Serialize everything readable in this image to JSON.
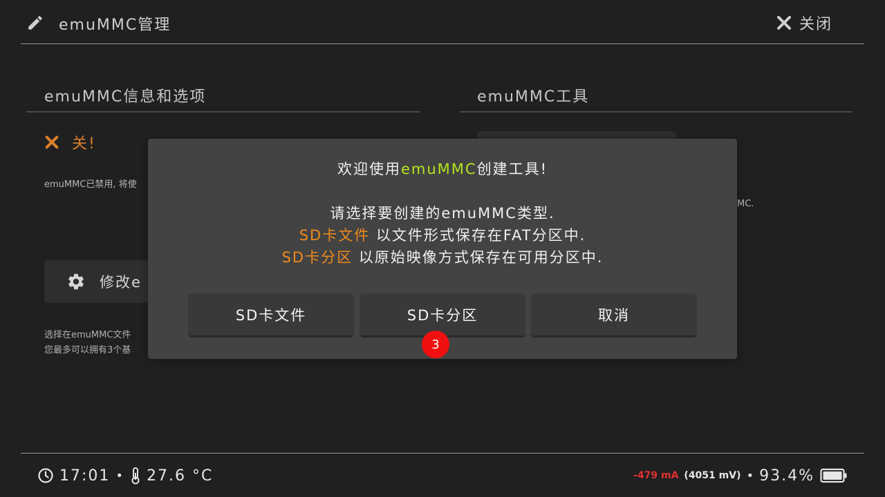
{
  "header": {
    "title": "emuMMC管理",
    "close_label": "关闭"
  },
  "left_panel": {
    "heading": "emuMMC信息和选项",
    "status_text": "关!",
    "status_desc": "emuMMC已禁用, 将使",
    "modify_button_label": "修改e",
    "help_line1": "选择在emuMMC文件",
    "help_line2": "您最多可以拥有3个基"
  },
  "right_panel": {
    "heading": "emuMMC工具",
    "desc_fragment": "MC."
  },
  "dialog": {
    "welcome_prefix": "欢迎使用",
    "welcome_highlight": "emuMMC",
    "welcome_suffix": "创建工具!",
    "prompt": "请选择要创建的emuMMC类型.",
    "option1_name": "SD卡文件",
    "option1_desc": " 以文件形式保存在FAT分区中.",
    "option2_name": "SD卡分区",
    "option2_desc": " 以原始映像方式保存在可用分区中.",
    "buttons": [
      "SD卡文件",
      "SD卡分区",
      "取消"
    ],
    "badge": "3"
  },
  "footer": {
    "time": "17:01",
    "separator": "•",
    "temperature": "27.6 °C",
    "current": "-479 mA",
    "voltage": "(4051 mV)",
    "battery_percent": "93.4%"
  },
  "colors": {
    "background": "#202020",
    "dialog": "#434343",
    "accent_green": "#b5e61d",
    "accent_orange": "#f28a1e",
    "status_orange": "#d9802a",
    "badge_red": "#f01010",
    "current_red": "#e0312f"
  },
  "icons": {
    "header": "pencil-icon",
    "close": "close-x-icon",
    "status": "x-icon",
    "modify": "gear-icon",
    "clock": "clock-icon",
    "temperature": "thermometer-icon",
    "battery": "battery-icon"
  }
}
